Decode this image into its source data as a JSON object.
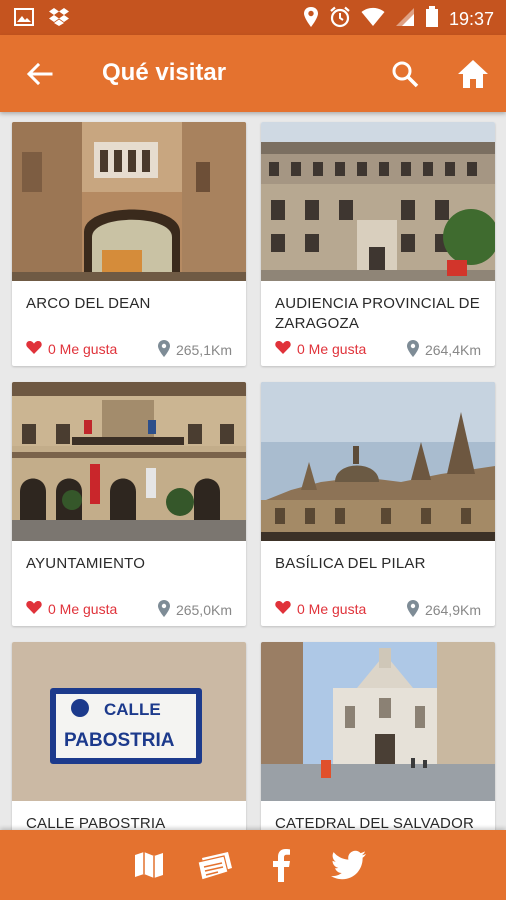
{
  "status_bar": {
    "time": "19:37",
    "left_icons": [
      "image-icon",
      "dropbox-icon"
    ],
    "right_icons": [
      "location-icon",
      "alarm-icon",
      "wifi-icon",
      "signal-icon",
      "battery-icon"
    ]
  },
  "app_bar": {
    "title": "Qué visitar",
    "icons": [
      "back-arrow-icon",
      "search-icon",
      "home-icon"
    ]
  },
  "places": [
    {
      "name": "ARCO DEL DEAN",
      "likes": "0 Me gusta",
      "distance": "265,1Km"
    },
    {
      "name": "AUDIENCIA PROVINCIAL DE ZARAGOZA",
      "likes": "0 Me gusta",
      "distance": "264,4Km"
    },
    {
      "name": "AYUNTAMIENTO",
      "likes": "0 Me gusta",
      "distance": "265,0Km"
    },
    {
      "name": "BASÍLICA DEL PILAR",
      "likes": "0 Me gusta",
      "distance": "264,9Km"
    },
    {
      "name": "CALLE PABOSTRIA",
      "likes": "",
      "distance": ""
    },
    {
      "name": "CATEDRAL DEL SALVADOR",
      "likes": "",
      "distance": ""
    }
  ],
  "sign": {
    "line1": "CALLE",
    "line2": "PABOSTRIA"
  },
  "bottom_bar": {
    "icons": [
      "map-icon",
      "newspaper-icon",
      "facebook-icon",
      "twitter-icon"
    ]
  },
  "colors": {
    "status_bar": "#c5541f",
    "app_bar": "#e4722f",
    "like_red": "#e0323a",
    "background": "#e9e9e9"
  }
}
